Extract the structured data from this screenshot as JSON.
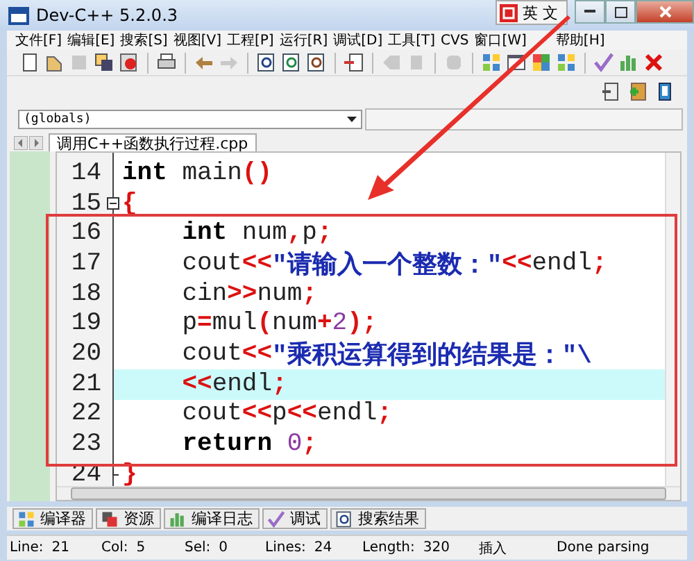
{
  "window": {
    "title": "Dev-C++ 5.2.0.3",
    "ime": "英 文"
  },
  "menu": [
    "文件[F]",
    "编辑[E]",
    "搜索[S]",
    "视图[V]",
    "工程[P]",
    "运行[R]",
    "调试[D]",
    "工具[T]",
    "CVS",
    "窗口[W]",
    "帮助[H]"
  ],
  "toolbar": [
    [
      {
        "kind": "new",
        "disabled": false
      },
      {
        "kind": "open",
        "disabled": false
      },
      {
        "kind": "save",
        "disabled": true
      },
      {
        "kind": "saveall",
        "disabled": false
      },
      {
        "kind": "close",
        "disabled": false
      }
    ],
    [
      {
        "kind": "print",
        "disabled": false
      }
    ],
    [
      {
        "kind": "undo",
        "disabled": false
      },
      {
        "kind": "redo",
        "disabled": true
      }
    ],
    [
      {
        "kind": "find",
        "disabled": false
      },
      {
        "kind": "replace",
        "disabled": false
      },
      {
        "kind": "findnext",
        "disabled": false
      }
    ],
    [
      {
        "kind": "goto",
        "disabled": false
      }
    ],
    [
      {
        "kind": "back",
        "disabled": true
      },
      {
        "kind": "forward",
        "disabled": true
      }
    ],
    [
      {
        "kind": "stop",
        "disabled": true
      }
    ],
    [
      {
        "kind": "grid",
        "disabled": false
      },
      {
        "kind": "window",
        "disabled": false
      },
      {
        "kind": "tiles",
        "disabled": false
      },
      {
        "kind": "grid",
        "disabled": false
      }
    ],
    [
      {
        "kind": "check",
        "disabled": false
      },
      {
        "kind": "chart",
        "disabled": false
      },
      {
        "kind": "cross",
        "disabled": false
      }
    ]
  ],
  "toolbar2": [
    {
      "kind": "project-out"
    },
    {
      "kind": "project-add"
    },
    {
      "kind": "book"
    }
  ],
  "scope_combo": {
    "value": "(globals)"
  },
  "tabs": [
    {
      "label": "调用C++函数执行过程.cpp",
      "selected": true
    }
  ],
  "code": [
    {
      "number": "14",
      "fold_start": false,
      "fold_end": false,
      "current": false,
      "tokens": [
        {
          "text": "int",
          "kind": "keyword"
        },
        {
          "text": " main",
          "kind": "ident"
        },
        {
          "text": "()",
          "kind": "symbol"
        }
      ]
    },
    {
      "number": "15",
      "fold_start": true,
      "fold_end": false,
      "current": false,
      "tokens": [
        {
          "text": "{",
          "kind": "symbol"
        }
      ]
    },
    {
      "number": "16",
      "fold_start": false,
      "fold_end": false,
      "current": false,
      "tokens": [
        {
          "text": "    int",
          "kind": "keyword"
        },
        {
          "text": " num",
          "kind": "ident"
        },
        {
          "text": ",",
          "kind": "symbol"
        },
        {
          "text": "p",
          "kind": "ident"
        },
        {
          "text": ";",
          "kind": "symbol"
        }
      ]
    },
    {
      "number": "17",
      "fold_start": false,
      "fold_end": false,
      "current": false,
      "tokens": [
        {
          "text": "    cout",
          "kind": "ident"
        },
        {
          "text": "<<",
          "kind": "symbol"
        },
        {
          "text": "\"请输入一个整数：\"",
          "kind": "string"
        },
        {
          "text": "<<",
          "kind": "symbol"
        },
        {
          "text": "endl",
          "kind": "ident"
        },
        {
          "text": ";",
          "kind": "symbol"
        }
      ]
    },
    {
      "number": "18",
      "fold_start": false,
      "fold_end": false,
      "current": false,
      "tokens": [
        {
          "text": "    cin",
          "kind": "ident"
        },
        {
          "text": ">>",
          "kind": "symbol"
        },
        {
          "text": "num",
          "kind": "ident"
        },
        {
          "text": ";",
          "kind": "symbol"
        }
      ]
    },
    {
      "number": "19",
      "fold_start": false,
      "fold_end": false,
      "current": false,
      "tokens": [
        {
          "text": "    p",
          "kind": "ident"
        },
        {
          "text": "=",
          "kind": "symbol"
        },
        {
          "text": "mul",
          "kind": "ident"
        },
        {
          "text": "(",
          "kind": "symbol"
        },
        {
          "text": "num",
          "kind": "ident"
        },
        {
          "text": "+",
          "kind": "symbol"
        },
        {
          "text": "2",
          "kind": "number"
        },
        {
          "text": ");",
          "kind": "symbol"
        }
      ]
    },
    {
      "number": "20",
      "fold_start": false,
      "fold_end": false,
      "current": false,
      "tokens": [
        {
          "text": "    cout",
          "kind": "ident"
        },
        {
          "text": "<<",
          "kind": "symbol"
        },
        {
          "text": "\"乘积运算得到的结果是：\"\\",
          "kind": "string"
        }
      ]
    },
    {
      "number": "21",
      "fold_start": false,
      "fold_end": false,
      "current": true,
      "tokens": [
        {
          "text": "    <<",
          "kind": "symbol"
        },
        {
          "text": "endl",
          "kind": "ident"
        },
        {
          "text": ";",
          "kind": "symbol"
        }
      ]
    },
    {
      "number": "22",
      "fold_start": false,
      "fold_end": false,
      "current": false,
      "tokens": [
        {
          "text": "    cout",
          "kind": "ident"
        },
        {
          "text": "<<",
          "kind": "symbol"
        },
        {
          "text": "p",
          "kind": "ident"
        },
        {
          "text": "<<",
          "kind": "symbol"
        },
        {
          "text": "endl",
          "kind": "ident"
        },
        {
          "text": ";",
          "kind": "symbol"
        }
      ]
    },
    {
      "number": "23",
      "fold_start": false,
      "fold_end": false,
      "current": false,
      "tokens": [
        {
          "text": "    return",
          "kind": "keyword"
        },
        {
          "text": " 0",
          "kind": "number"
        },
        {
          "text": ";",
          "kind": "symbol"
        }
      ]
    },
    {
      "number": "24",
      "fold_start": false,
      "fold_end": true,
      "current": false,
      "tokens": [
        {
          "text": "}",
          "kind": "symbol"
        }
      ]
    }
  ],
  "bottom_tabs": [
    {
      "label": "编译器",
      "kind": "grid"
    },
    {
      "label": "资源",
      "kind": "pages"
    },
    {
      "label": "编译日志",
      "kind": "chart"
    },
    {
      "label": "调试",
      "kind": "check"
    },
    {
      "label": "搜索结果",
      "kind": "find"
    }
  ],
  "status_bar": [
    {
      "label": "Line:",
      "value": "21"
    },
    {
      "label": "Col:",
      "value": "5"
    },
    {
      "label": "Sel:",
      "value": "0"
    },
    {
      "label": "Lines:",
      "value": "24"
    },
    {
      "label": "Length:",
      "value": "320"
    },
    {
      "value": "插入"
    },
    {
      "value": "Done parsing"
    }
  ]
}
